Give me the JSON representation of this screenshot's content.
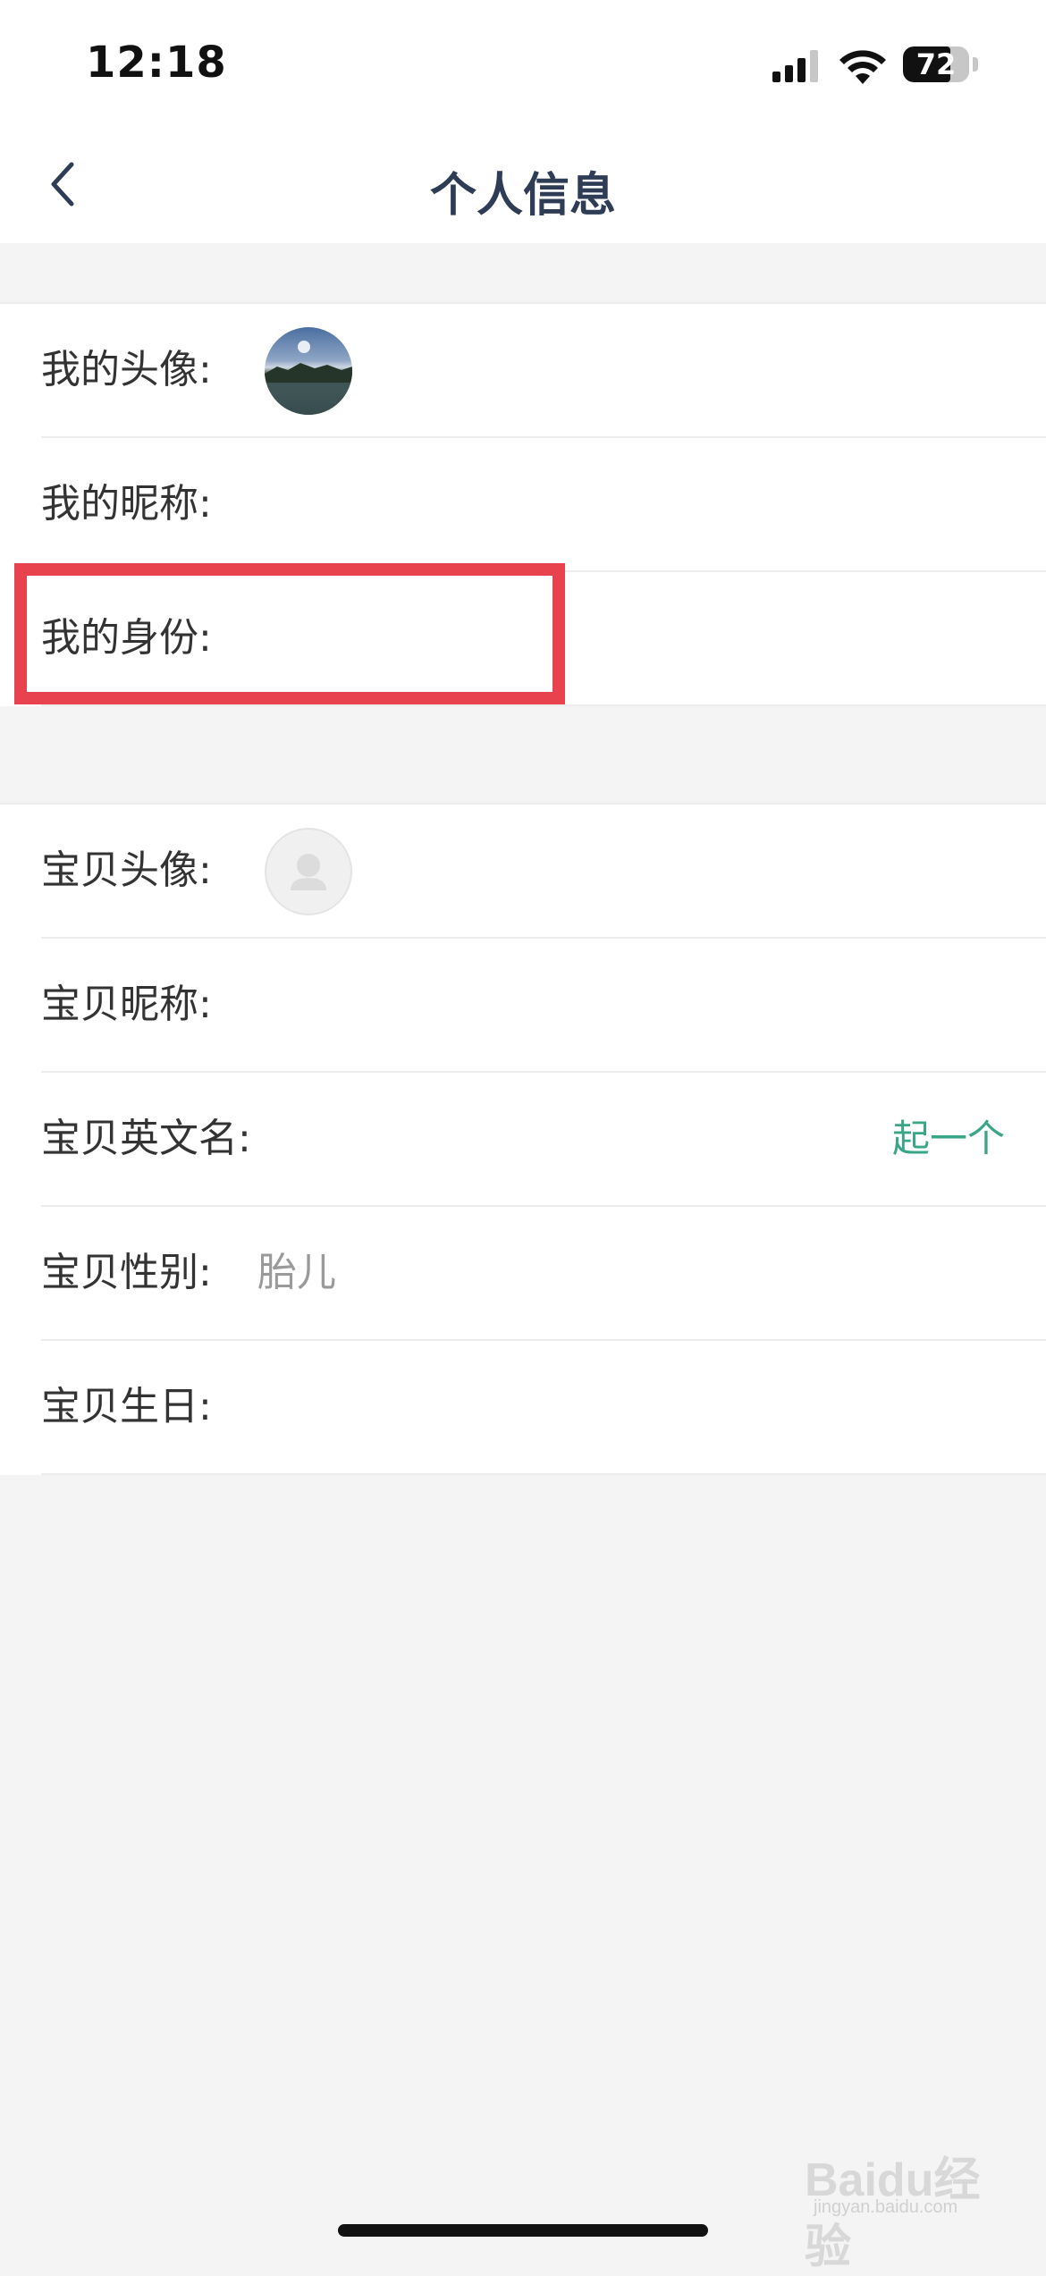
{
  "status_bar": {
    "time": "12:18",
    "battery": "72",
    "battery_level": 0.72,
    "icons": [
      "signal-icon",
      "wifi-icon",
      "battery-icon"
    ]
  },
  "nav": {
    "title": "个人信息",
    "back_icon": "chevron-left-icon"
  },
  "my_info": {
    "avatar_label": "我的头像:",
    "nickname_label": "我的昵称:",
    "identity_label": "我的身份:"
  },
  "baby_info": {
    "avatar_label": "宝贝头像:",
    "nickname_label": "宝贝昵称:",
    "english_name_label": "宝贝英文名:",
    "english_name_action": "起一个",
    "gender_label": "宝贝性别:",
    "gender_value": "胎儿",
    "birthday_label": "宝贝生日:"
  },
  "watermark": {
    "main": "Baidu经验",
    "sub": "jingyan.baidu.com"
  },
  "colors": {
    "accent_green": "#3aa688",
    "highlight_red": "#e8424f",
    "title": "#2f3c55",
    "background": "#f4f4f4"
  }
}
